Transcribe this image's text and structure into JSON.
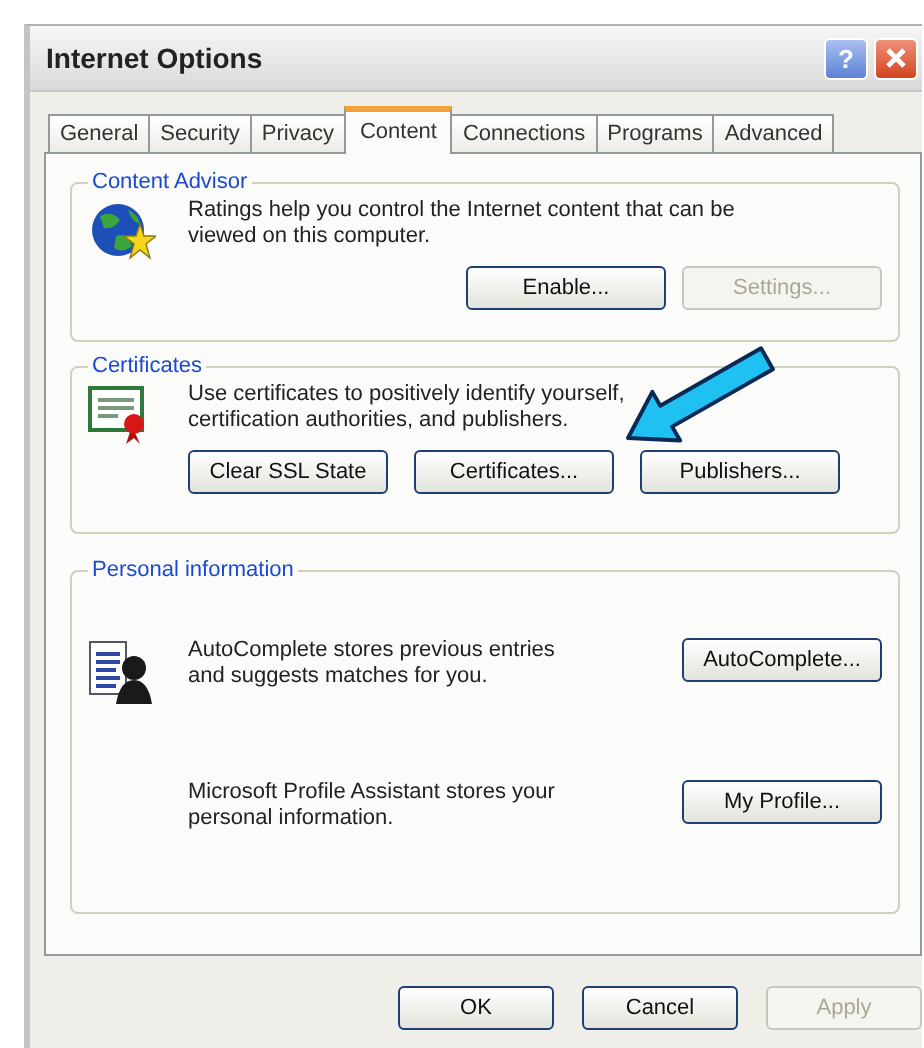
{
  "window": {
    "title": "Internet Options",
    "help_label": "?"
  },
  "tabs": [
    {
      "label": "General",
      "selected": false
    },
    {
      "label": "Security",
      "selected": false
    },
    {
      "label": "Privacy",
      "selected": false
    },
    {
      "label": "Content",
      "selected": true
    },
    {
      "label": "Connections",
      "selected": false
    },
    {
      "label": "Programs",
      "selected": false
    },
    {
      "label": "Advanced",
      "selected": false
    }
  ],
  "groups": [
    {
      "title": "Content Advisor",
      "sections": [
        {
          "kind": "stacked",
          "description": "Ratings help you control the Internet content that can be viewed on this computer.",
          "buttons": [
            {
              "label": "Enable...",
              "disabled": false
            },
            {
              "label": "Settings...",
              "disabled": true
            }
          ]
        }
      ]
    },
    {
      "title": "Certificates",
      "sections": [
        {
          "kind": "stacked",
          "description": "Use certificates to positively identify yourself, certification authorities, and publishers.",
          "buttons": [
            {
              "label": "Clear SSL State",
              "disabled": false
            },
            {
              "label": "Certificates...",
              "disabled": false
            },
            {
              "label": "Publishers...",
              "disabled": false
            }
          ]
        }
      ]
    },
    {
      "title": "Personal information",
      "sections": [
        {
          "kind": "inline",
          "description": "AutoComplete stores previous entries and suggests matches for you.",
          "buttons": [
            {
              "label": "AutoComplete...",
              "disabled": false
            }
          ]
        },
        {
          "kind": "inline",
          "description": "Microsoft Profile Assistant stores your personal information.",
          "buttons": [
            {
              "label": "My Profile...",
              "disabled": false
            }
          ]
        }
      ]
    }
  ],
  "footer_buttons": [
    {
      "label": "OK",
      "disabled": false
    },
    {
      "label": "Cancel",
      "disabled": false
    },
    {
      "label": "Apply",
      "disabled": true
    }
  ]
}
